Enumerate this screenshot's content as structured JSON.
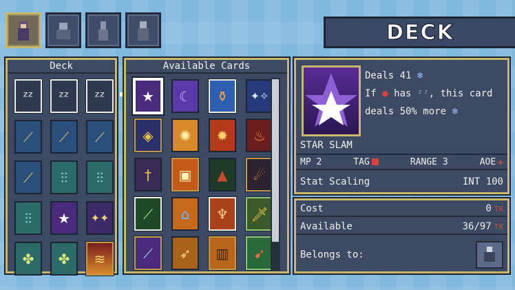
{
  "characters": [
    {
      "name": "character-1",
      "selected": true
    },
    {
      "name": "character-2",
      "selected": false
    },
    {
      "name": "character-3",
      "selected": false
    },
    {
      "name": "character-4",
      "selected": false
    }
  ],
  "header": {
    "title": "DECK"
  },
  "deck_panel": {
    "title": "Deck"
  },
  "available_panel": {
    "title": "Available Cards"
  },
  "card_info": {
    "name": "STAR SLAM",
    "desc_line1": "Deals 41",
    "desc_line2a": "If",
    "desc_line2b": "has",
    "desc_line2c": ", this card",
    "desc_line3": "deals 50% more",
    "mp": "MP 2",
    "tag": "TAG",
    "range": "RANGE 3",
    "aoe": "AOE",
    "stat_scaling_label": "Stat Scaling",
    "stat_scaling_value": "INT 100"
  },
  "cost_info": {
    "cost_label": "Cost",
    "cost_value": "0",
    "cost_unit": "TK",
    "available_label": "Available",
    "available_value": "36/97",
    "available_unit": "TK",
    "belongs_label": "Belongs to:"
  },
  "colors": {
    "accent_gold": "#c9b86a",
    "panel_bg": "#3d4a63",
    "red": "#d6453f"
  }
}
